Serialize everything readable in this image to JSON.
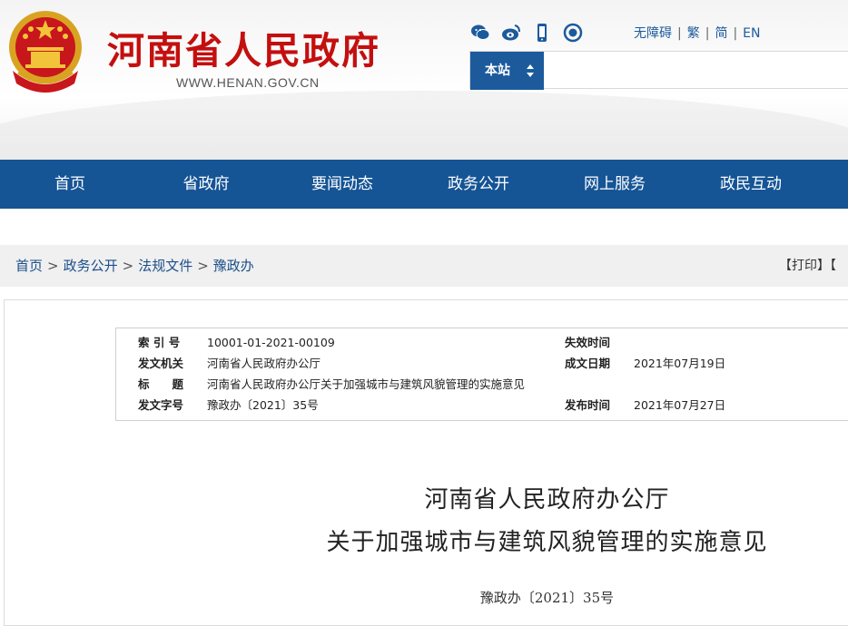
{
  "header": {
    "site_name": "河南省人民政府",
    "site_url": "WWW.HENAN.GOV.CN",
    "social_icons": [
      "wechat-icon",
      "weibo-icon",
      "mobile-icon",
      "podcast-icon"
    ],
    "lang_links": [
      "无障碍",
      "繁",
      "简",
      "EN"
    ],
    "search": {
      "scope_label": "本站",
      "placeholder": ""
    }
  },
  "nav": [
    "首页",
    "省政府",
    "要闻动态",
    "政务公开",
    "网上服务",
    "政民互动"
  ],
  "breadcrumb": [
    "首页",
    "政务公开",
    "法规文件",
    "豫政办"
  ],
  "print_label": "【打印】【",
  "meta": {
    "index_label": "索 引 号",
    "index_value": "10001-01-2021-00109",
    "expire_label": "失效时间",
    "expire_value": "",
    "issuer_label": "发文机关",
    "issuer_value": "河南省人民政府办公厅",
    "date_label": "成文日期",
    "date_value": "2021年07月19日",
    "title_label": "标　　题",
    "title_value": "河南省人民政府办公厅关于加强城市与建筑风貌管理的实施意见",
    "docno_label": "发文字号",
    "docno_value": "豫政办〔2021〕35号",
    "publish_label": "发布时间",
    "publish_value": "2021年07月27日"
  },
  "document": {
    "title_line1": "河南省人民政府办公厅",
    "title_line2": "关于加强城市与建筑风貌管理的实施意见",
    "doc_number": "豫政办〔2021〕35号"
  },
  "colors": {
    "brand_red": "#c40f0f",
    "nav_blue": "#155495",
    "link_blue": "#1c5a9c"
  }
}
